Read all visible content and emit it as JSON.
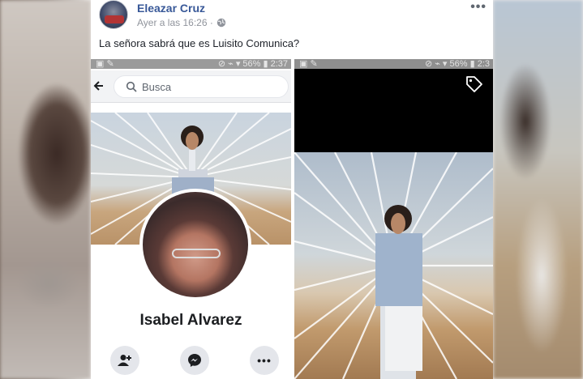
{
  "post": {
    "author": "Eleazar Cruz",
    "timestamp": "Ayer a las 16:26 ·",
    "text": "La señora sabrá que es Luisito Comunica?",
    "privacy_icon": "globe-icon",
    "more_label": "•••"
  },
  "left_screenshot": {
    "status": {
      "left_icons": "▣ ✎",
      "right_info": "⊘ ⌁ ▾ 56% ▮ 2:37"
    },
    "search": {
      "placeholder": "Busca"
    },
    "profile": {
      "name": "Isabel Alvarez"
    },
    "actions": [
      {
        "icon": "add-friend-icon"
      },
      {
        "icon": "messenger-icon"
      },
      {
        "icon": "more-icon",
        "label": "•••"
      }
    ]
  },
  "right_screenshot": {
    "status": {
      "left_icons": "▣ ✎",
      "right_info": "⊘ ⌁ ▾ 56% ▮ 2:3"
    },
    "tag_icon": "tag-icon"
  },
  "colors": {
    "link_blue": "#385898",
    "meta_gray": "#90949c",
    "button_gray": "#e4e6eb"
  }
}
